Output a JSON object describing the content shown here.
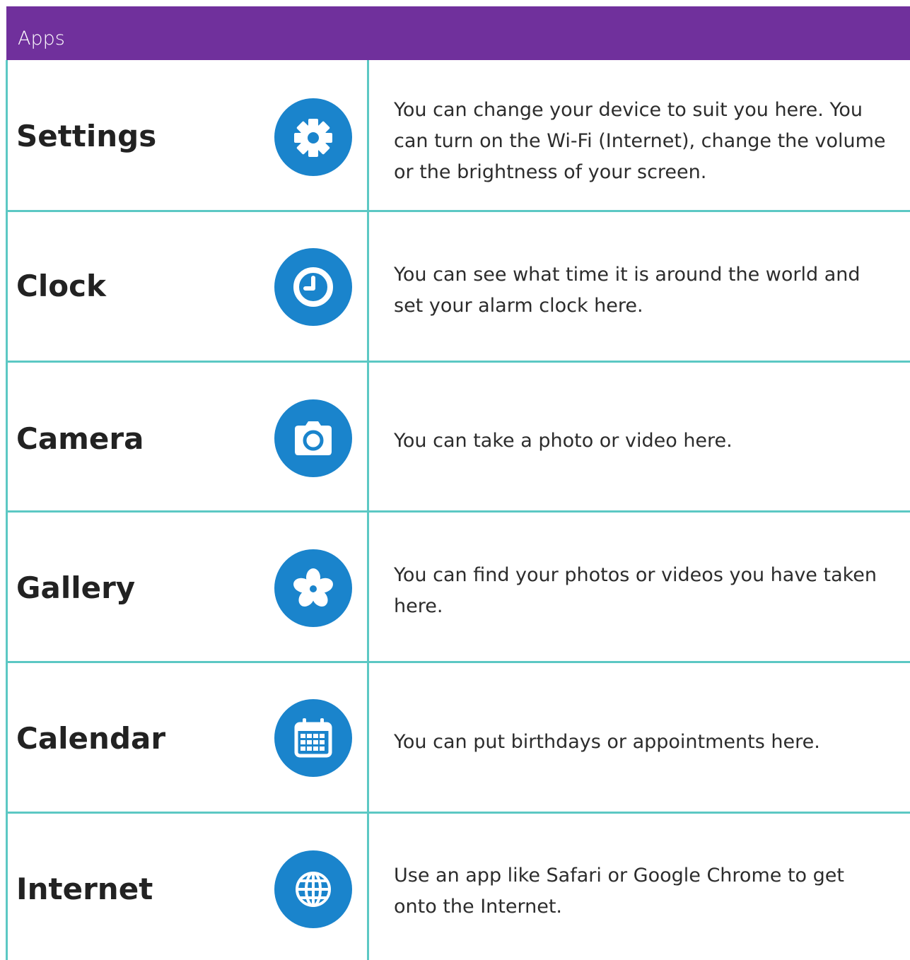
{
  "header": {
    "title": "Apps"
  },
  "apps": [
    {
      "name": "Settings",
      "icon": "gear-icon",
      "description": "You can change your device to suit you here. You can turn on the Wi-Fi (Internet), change the volume or the brightness of your screen."
    },
    {
      "name": "Clock",
      "icon": "clock-icon",
      "description": "You can see what time it is around the world and set your alarm clock here."
    },
    {
      "name": "Camera",
      "icon": "camera-icon",
      "description": "You can take a photo or video here."
    },
    {
      "name": "Gallery",
      "icon": "flower-icon",
      "description": "You can find your photos or videos you have taken here."
    },
    {
      "name": "Calendar",
      "icon": "calendar-icon",
      "description": "You can put birthdays or appointments here."
    },
    {
      "name": "Internet",
      "icon": "globe-icon",
      "description": "Use an app like Safari or Google Chrome to get onto the Internet."
    }
  ],
  "colors": {
    "header": "#70309c",
    "grid": "#5cc8c4",
    "icon": "#1a84cc"
  }
}
